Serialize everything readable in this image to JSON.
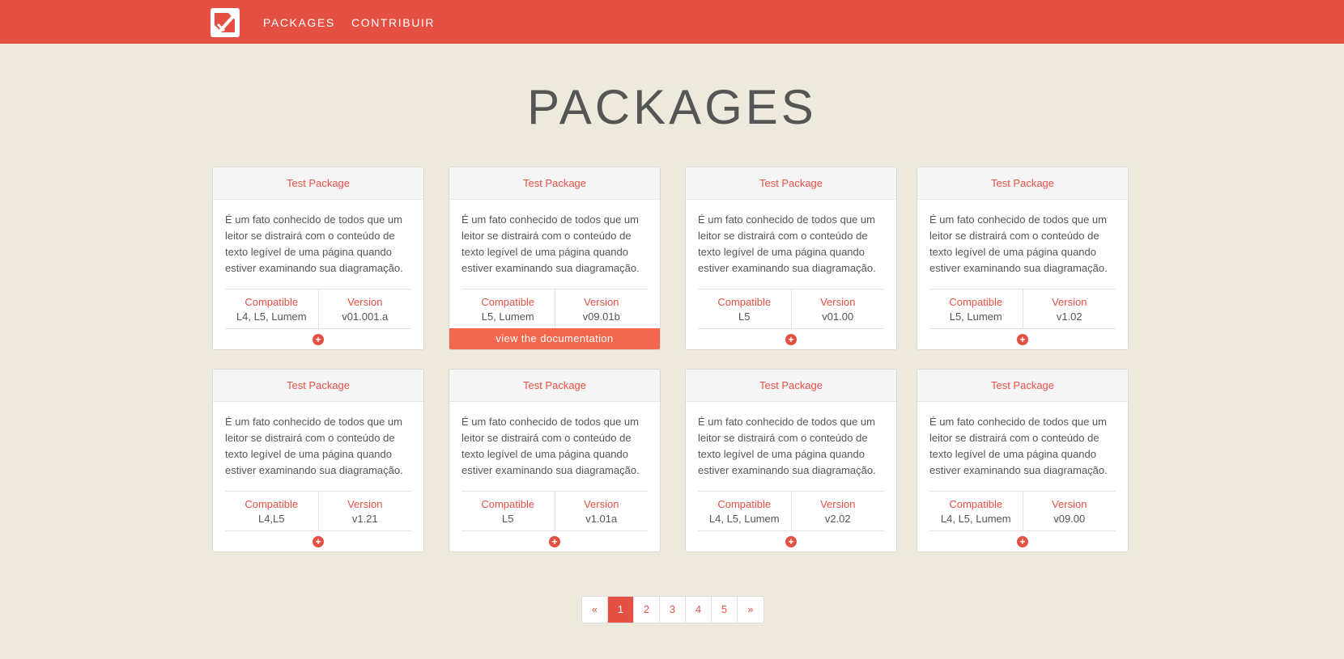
{
  "nav": {
    "items": [
      "PACKAGES",
      "CONTRIBUIR"
    ]
  },
  "page": {
    "title": "PACKAGES"
  },
  "colors": {
    "accent": "#e55044",
    "background": "#ede9dd",
    "doc_button": "#f4674f"
  },
  "labels": {
    "compatible": "Compatible",
    "version": "Version",
    "doc_button": "view the documentation"
  },
  "cards": [
    {
      "title": "Test Package",
      "desc": "É um fato conhecido de todos que um leitor se distrairá com o conteúdo de texto legível de uma página quando estiver examinando sua diagramação.",
      "compatible": "L4, L5, Lumem",
      "version": "v01.001.a"
    },
    {
      "title": "Test Package",
      "desc": "É um fato conhecido de todos que um leitor se distrairá com o conteúdo de texto legível de uma página quando estiver examinando sua diagramação.",
      "compatible": "L5, Lumem",
      "version": "v09.01b",
      "hover": true
    },
    {
      "title": "Test Package",
      "desc": "É um fato conhecido de todos que um leitor se distrairá com o conteúdo de texto legível de uma página quando estiver examinando sua diagramação.",
      "compatible": "L5",
      "version": "v01.00"
    },
    {
      "title": "Test Package",
      "desc": "É um fato conhecido de todos que um leitor se distrairá com o conteúdo de texto legível de uma página quando estiver examinando sua diagramação.",
      "compatible": "L5, Lumem",
      "version": "v1.02"
    },
    {
      "title": "Test Package",
      "desc": "É um fato conhecido de todos que um leitor se distrairá com o conteúdo de texto legível de uma página quando estiver examinando sua diagramação.",
      "compatible": "L4,L5",
      "version": "v1.21"
    },
    {
      "title": "Test Package",
      "desc": "É um fato conhecido de todos que um leitor se distrairá com o conteúdo de texto legível de uma página quando estiver examinando sua diagramação.",
      "compatible": "L5",
      "version": "v1.01a"
    },
    {
      "title": "Test Package",
      "desc": "É um fato conhecido de todos que um leitor se distrairá com o conteúdo de texto legível de uma página quando estiver examinando sua diagramação.",
      "compatible": "L4, L5, Lumem",
      "version": "v2.02"
    },
    {
      "title": "Test Package",
      "desc": "É um fato conhecido de todos que um leitor se distrairá com o conteúdo de texto legível de uma página quando estiver examinando sua diagramação.",
      "compatible": "L4, L5, Lumem",
      "version": "v09.00"
    }
  ],
  "pagination": {
    "prev": "«",
    "pages": [
      "1",
      "2",
      "3",
      "4",
      "5"
    ],
    "next": "»",
    "current": "1"
  }
}
